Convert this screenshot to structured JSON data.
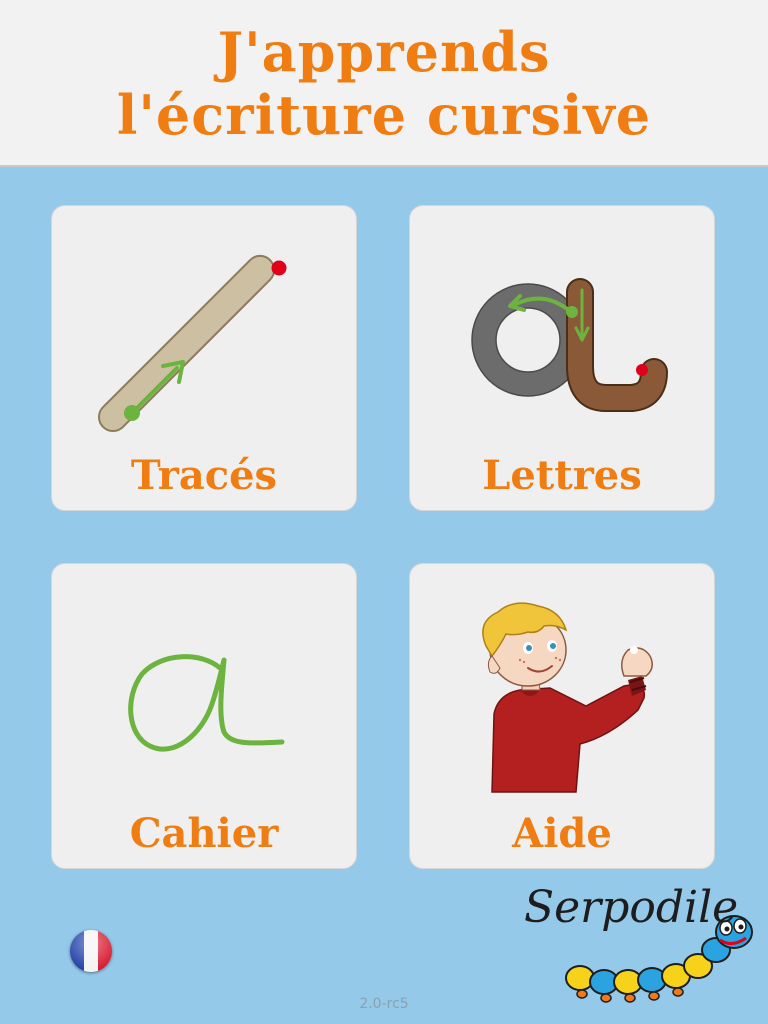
{
  "header": {
    "title_line1": "J'apprends",
    "title_line2": "l'écriture cursive"
  },
  "menu": {
    "traces": {
      "label": "Tracés",
      "icon": "stroke-icon"
    },
    "lettres": {
      "label": "Lettres",
      "icon": "letter-a-guide-icon"
    },
    "cahier": {
      "label": "Cahier",
      "icon": "handwritten-a-icon"
    },
    "aide": {
      "label": "Aide",
      "icon": "boy-writing-icon"
    }
  },
  "footer": {
    "version": "2.0-rc5",
    "language_flag": "france-flag-icon",
    "logo": "Serpodile"
  },
  "colors": {
    "background": "#95c9ea",
    "header_bg": "#f2f2f2",
    "accent_orange": "#ef7d12",
    "tile_bg": "#efefef",
    "guide_green": "#6cb33f",
    "start_red": "#e1001a"
  }
}
